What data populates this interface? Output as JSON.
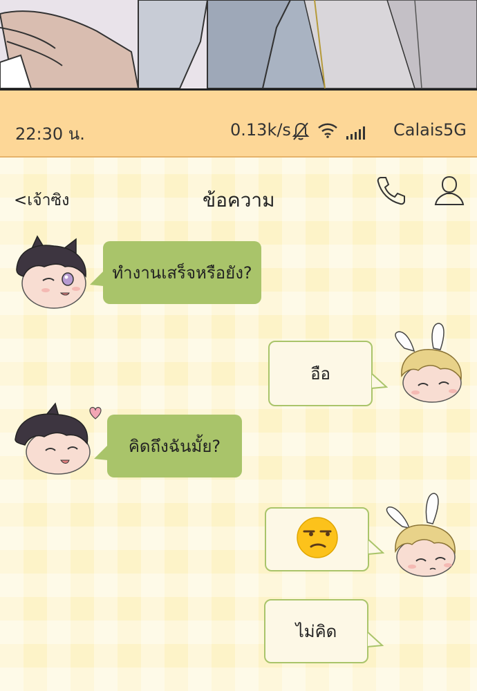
{
  "status_bar": {
    "time": "22:30 น.",
    "network_speed": "0.13k/s",
    "carrier": "Calais5G",
    "icons": [
      "mute-bell-icon",
      "wifi-icon",
      "signal-icon"
    ]
  },
  "nav": {
    "back_label": "<เจ้าซิง",
    "title": "ข้อความ",
    "icons": [
      "phone-icon",
      "profile-icon"
    ]
  },
  "messages": [
    {
      "direction": "incoming",
      "sender_avatar": "cat-ear-boy-avatar",
      "text": "ทำงานเสร็จหรือยัง?"
    },
    {
      "direction": "outgoing",
      "sender_avatar": "bunny-ear-boy-avatar",
      "text": "อือ"
    },
    {
      "direction": "incoming",
      "sender_avatar": "cat-ear-boy-avatar",
      "text": "คิดถึงฉันมั้ย?"
    },
    {
      "direction": "outgoing",
      "sender_avatar": "bunny-ear-boy-avatar",
      "text": "",
      "emoji": "unamused-face-icon"
    },
    {
      "direction": "outgoing",
      "text": "ไม่คิด"
    }
  ],
  "colors": {
    "status_bar": "#fdd797",
    "chat_background": "#fdf3c8",
    "incoming_bubble": "#a9c46a",
    "outgoing_bubble": "#fdf8e6"
  }
}
